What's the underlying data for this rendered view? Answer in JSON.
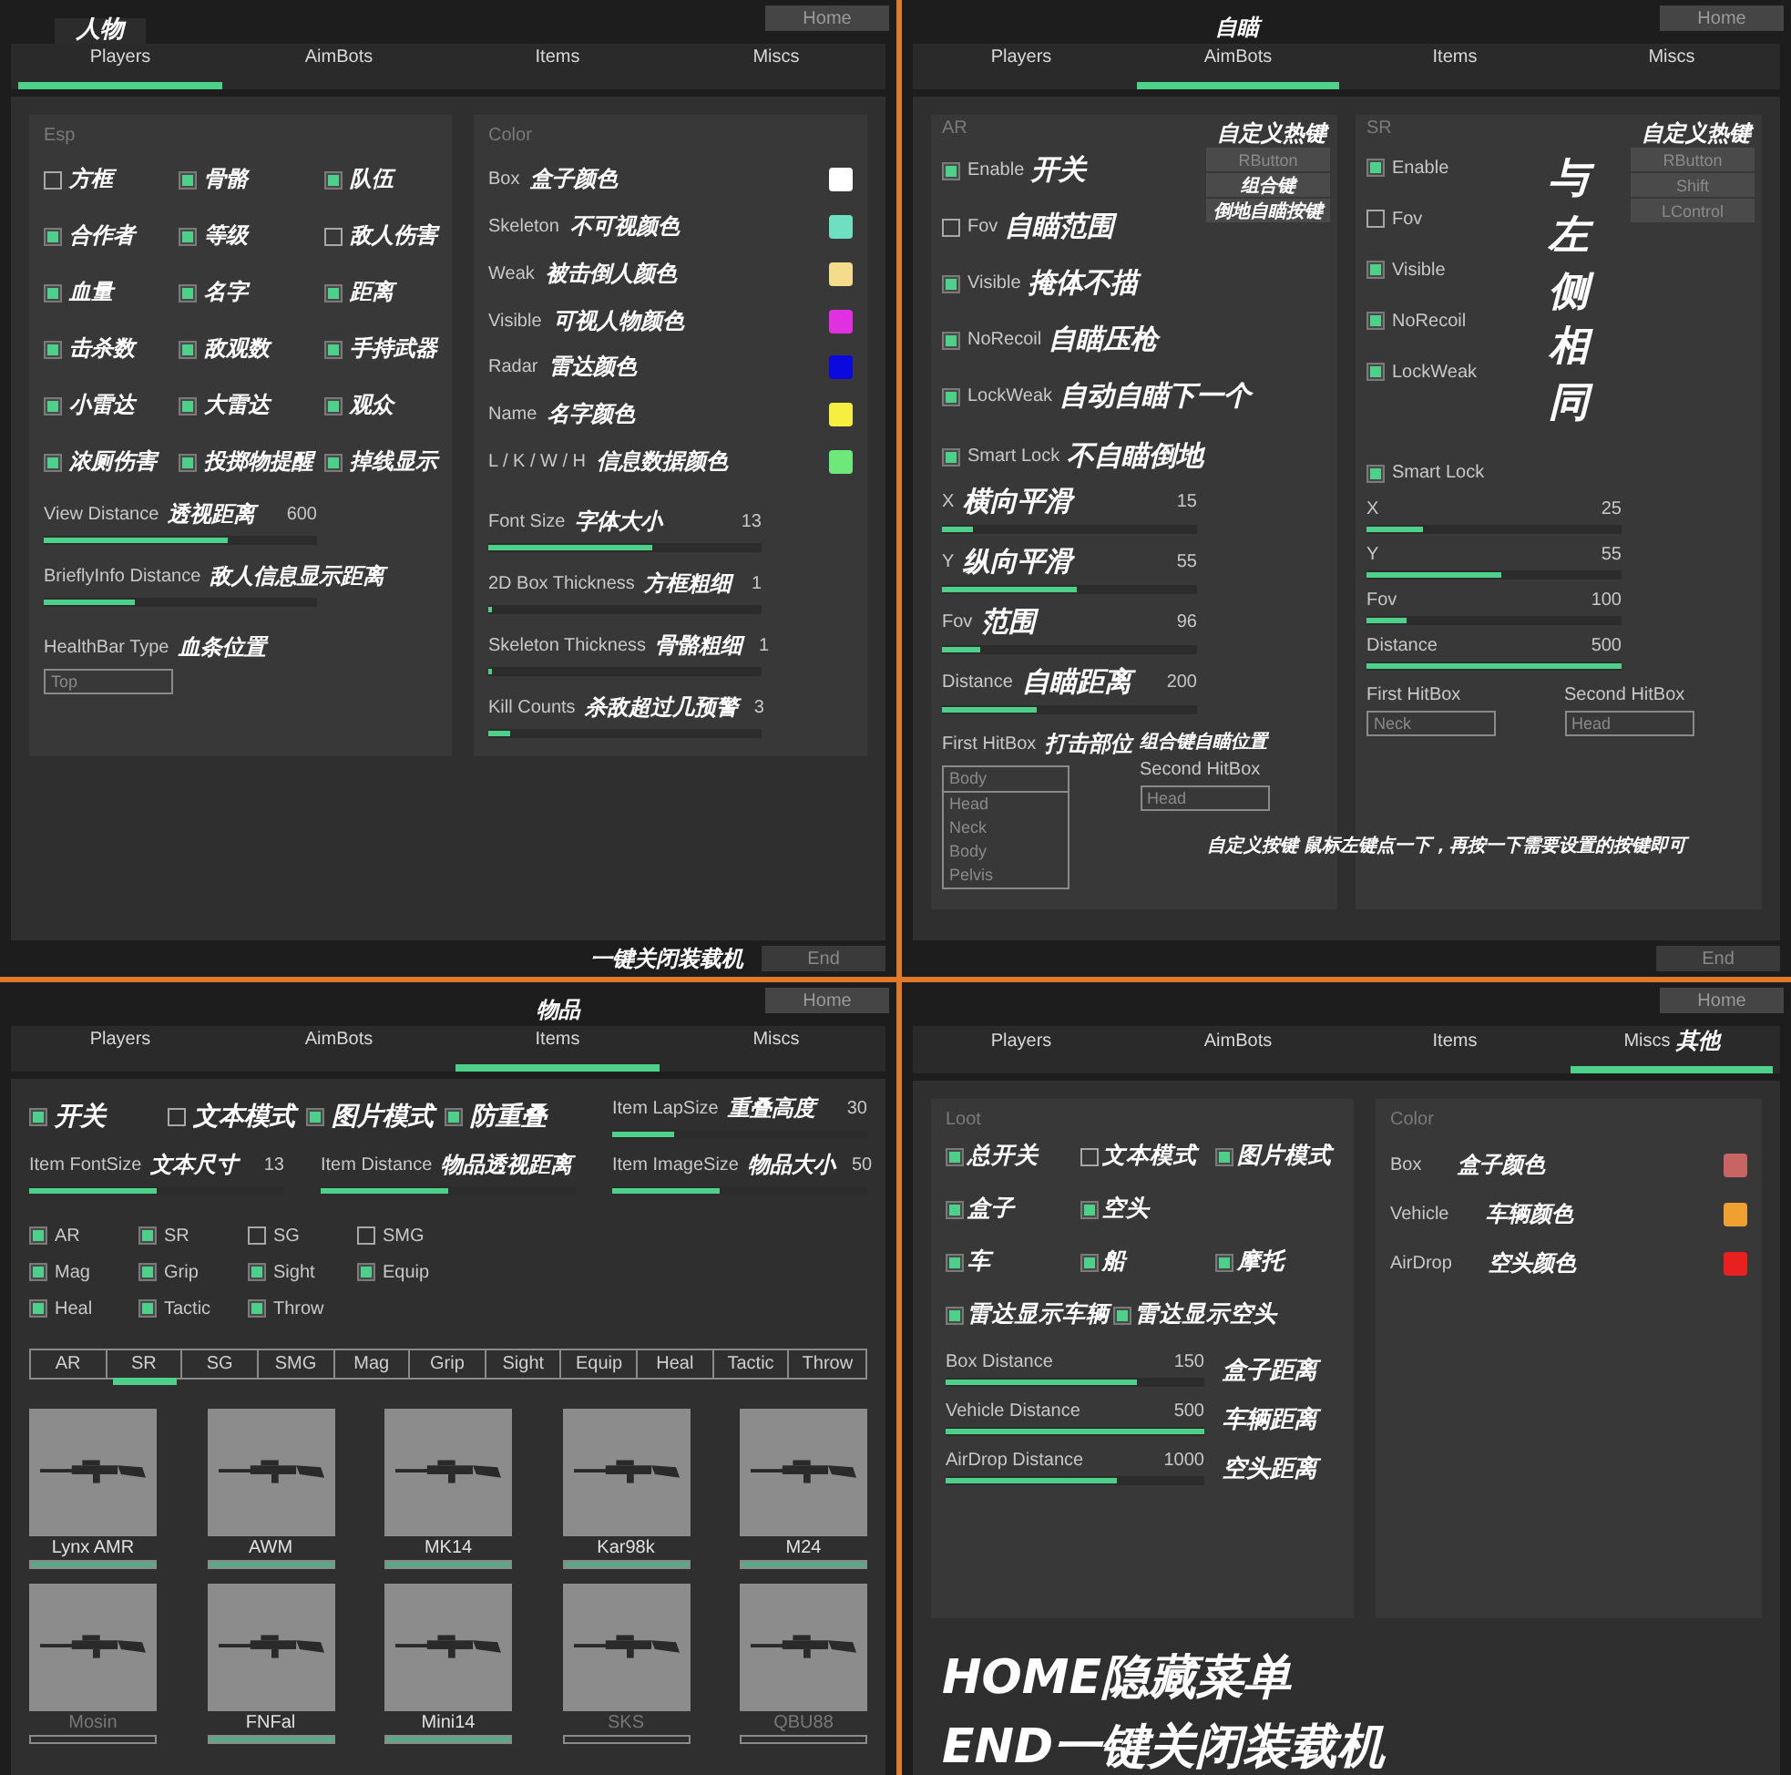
{
  "panels": [
    {
      "kind": "players",
      "title_note": "人物",
      "home": "Home",
      "tabs": [
        {
          "label": "Players",
          "selected": true
        },
        {
          "label": "AimBots",
          "selected": false
        },
        {
          "label": "Items",
          "selected": false
        },
        {
          "label": "Miscs",
          "selected": false
        }
      ],
      "esp": {
        "title": "Esp",
        "checks": [
          {
            "note": "方框",
            "checked": false
          },
          {
            "note": "骨骼",
            "checked": true
          },
          {
            "note": "队伍",
            "checked": true
          },
          {
            "note": "合作者",
            "checked": true
          },
          {
            "note": "等级",
            "checked": true
          },
          {
            "note": "敌人伤害",
            "checked": false
          },
          {
            "note": "血量",
            "checked": true
          },
          {
            "note": "名字",
            "checked": true
          },
          {
            "note": "距离",
            "checked": true
          },
          {
            "note": "击杀数",
            "checked": true
          },
          {
            "note": "敌观数",
            "checked": true
          },
          {
            "note": "手持武器",
            "checked": true
          },
          {
            "note": "小雷达",
            "checked": true
          },
          {
            "note": "大雷达",
            "checked": true
          },
          {
            "note": "观众",
            "checked": true
          },
          {
            "note": "浓厕伤害",
            "checked": true
          },
          {
            "note": "投掷物提醒",
            "checked": true
          },
          {
            "note": "掉线显示",
            "checked": true
          }
        ],
        "sliders": [
          {
            "label": "View Distance",
            "note": "透视距离",
            "value": "600",
            "level": 0.67
          },
          {
            "label": "BrieflyInfo Distance",
            "note": "敌人信息显示距离",
            "level": 0.33
          }
        ],
        "healthbar": {
          "label": "HealthBar Type",
          "note": "血条位置",
          "value": "Top"
        }
      },
      "color": {
        "title": "Color",
        "rows": [
          {
            "label": "Box",
            "note": "盒子颜色",
            "color": "#ffffff"
          },
          {
            "label": "Skeleton",
            "note": "不可视颜色",
            "color": "#6ee0c0"
          },
          {
            "label": "Weak",
            "note": "被击倒人颜色",
            "color": "#f5dc8c"
          },
          {
            "label": "Visible",
            "note": "可视人物颜色",
            "color": "#e030e0"
          },
          {
            "label": "Radar",
            "note": "雷达颜色",
            "color": "#0a0ae0"
          },
          {
            "label": "Name",
            "note": "名字颜色",
            "color": "#f5f040"
          },
          {
            "label": "L / K / W / H",
            "note": "信息数据颜色",
            "color": "#6ee878"
          }
        ],
        "sliders": [
          {
            "label": "Font Size",
            "note": "字体大小",
            "value": "13",
            "level": 0.6
          },
          {
            "label": "2D Box Thickness",
            "note": "方框粗细",
            "value": "1",
            "level": 0.01
          },
          {
            "label": "Skeleton Thickness",
            "note": "骨骼粗细",
            "value": "1",
            "level": 0.01
          },
          {
            "label": "Kill Counts",
            "note": "杀敌超过几预警",
            "value": "3",
            "level": 0.08
          }
        ]
      },
      "footer_note": "一键关闭装载机",
      "end": "End"
    },
    {
      "kind": "aimbots",
      "title_note": "自瞄",
      "home": "Home",
      "tabs": [
        {
          "label": "Players",
          "selected": false
        },
        {
          "label": "AimBots",
          "selected": true
        },
        {
          "label": "Items",
          "selected": false
        },
        {
          "label": "Miscs",
          "selected": false
        }
      ],
      "groups": [
        {
          "title": "AR",
          "hotkey_note": "自定义热键",
          "keys": [
            {
              "kind": "key",
              "text": "RButton"
            },
            {
              "kind": "note",
              "text": "组合键"
            },
            {
              "kind": "note",
              "text": "倒地自瞄按键"
            }
          ],
          "checks": [
            {
              "label": "Enable",
              "note": "开关",
              "checked": true
            },
            {
              "label": "Fov",
              "note": "自瞄范围",
              "checked": false
            },
            {
              "label": "Visible",
              "note": "掩体不描",
              "checked": true
            },
            {
              "label": "NoRecoil",
              "note": "自瞄压枪",
              "checked": true
            },
            {
              "label": "LockWeak",
              "note": "自动自瞄下一个",
              "checked": true
            }
          ],
          "smart_lock": {
            "label": "Smart Lock",
            "note": "不自瞄倒地",
            "checked": true
          },
          "sliders": [
            {
              "label": "X",
              "note": "横向平滑",
              "value": "15",
              "level": 0.12
            },
            {
              "label": "Y",
              "note": "纵向平滑",
              "value": "55",
              "level": 0.53
            },
            {
              "label": "Fov",
              "note": "范围",
              "value": "96",
              "level": 0.15
            },
            {
              "label": "Distance",
              "note": "自瞄距离",
              "value": "200",
              "level": 0.37
            }
          ],
          "first_hitbox": {
            "kind": "list",
            "label": "First HitBox",
            "note": "打击部位",
            "options": [
              {
                "text": "Body",
                "selected": true
              },
              {
                "text": "Head",
                "selected": false
              },
              {
                "text": "Neck",
                "selected": false
              },
              {
                "text": "Body",
                "selected": false
              },
              {
                "text": "Pelvis",
                "selected": false
              }
            ]
          },
          "second_hitbox": {
            "label": "Second HitBox",
            "note": "组合键自瞄位置",
            "value": "Head"
          }
        },
        {
          "title": "SR",
          "hotkey_note": "自定义热键",
          "side_note": "与左侧相同",
          "keys": [
            {
              "kind": "key",
              "text": "RButton"
            },
            {
              "kind": "key",
              "text": "Shift"
            },
            {
              "kind": "key",
              "text": "LControl"
            }
          ],
          "checks": [
            {
              "label": "Enable",
              "checked": true
            },
            {
              "label": "Fov",
              "checked": false
            },
            {
              "label": "Visible",
              "checked": true
            },
            {
              "label": "NoRecoil",
              "checked": true
            },
            {
              "label": "LockWeak",
              "checked": true
            }
          ],
          "smart_lock": {
            "label": "Smart Lock",
            "checked": true
          },
          "sliders": [
            {
              "label": "X",
              "value": "25",
              "level": 0.22
            },
            {
              "label": "Y",
              "value": "55",
              "level": 0.53
            },
            {
              "label": "Fov",
              "value": "100",
              "level": 0.16
            },
            {
              "label": "Distance",
              "value": "500",
              "level": 1.0
            }
          ],
          "first_hitbox": {
            "kind": "field",
            "label": "First HitBox",
            "value": "Neck"
          },
          "second_hitbox": {
            "label": "Second HitBox",
            "value": "Head"
          }
        }
      ],
      "hint_note": "自定义按键 鼠标左键点一下，再按一下需要设置的按键即可",
      "end": "End"
    },
    {
      "kind": "items",
      "title_note": "物品",
      "home": "Home",
      "tabs": [
        {
          "label": "Players",
          "selected": false
        },
        {
          "label": "AimBots",
          "selected": false
        },
        {
          "label": "Items",
          "selected": true
        },
        {
          "label": "Miscs",
          "selected": false
        }
      ],
      "checks": [
        {
          "note": "开关",
          "checked": true
        },
        {
          "note": "文本模式",
          "checked": false
        },
        {
          "note": "图片模式",
          "checked": true
        },
        {
          "note": "防重叠",
          "checked": true
        }
      ],
      "lap": {
        "label": "Item LapSize",
        "note": "重叠高度",
        "value": "30",
        "level": 0.24
      },
      "sliders": [
        {
          "label": "Item FontSize",
          "note": "文本尺寸",
          "value": "13",
          "level": 0.5
        },
        {
          "label": "Item Distance",
          "note": "物品透视距离",
          "level": 0.5
        },
        {
          "label": "Item ImageSize",
          "note": "物品大小",
          "value": "50",
          "level": 0.42
        }
      ],
      "categories": [
        {
          "label": "AR",
          "checked": true
        },
        {
          "label": "SR",
          "checked": true
        },
        {
          "label": "SG",
          "checked": false
        },
        {
          "label": "SMG",
          "checked": false
        },
        {
          "label": "Mag",
          "checked": true
        },
        {
          "label": "Grip",
          "checked": true
        },
        {
          "label": "Sight",
          "checked": true
        },
        {
          "label": "Equip",
          "checked": true
        },
        {
          "label": "Heal",
          "checked": true
        },
        {
          "label": "Tactic",
          "checked": true
        },
        {
          "label": "Throw",
          "checked": true
        }
      ],
      "category_tabs": [
        {
          "label": "AR",
          "selected": false
        },
        {
          "label": "SR",
          "selected": true
        },
        {
          "label": "SG",
          "selected": false
        },
        {
          "label": "SMG",
          "selected": false
        },
        {
          "label": "Mag",
          "selected": false
        },
        {
          "label": "Grip",
          "selected": false
        },
        {
          "label": "Sight",
          "selected": false
        },
        {
          "label": "Equip",
          "selected": false
        },
        {
          "label": "Heal",
          "selected": false
        },
        {
          "label": "Tactic",
          "selected": false
        },
        {
          "label": "Throw",
          "selected": false
        }
      ],
      "items": [
        {
          "name": "Lynx AMR",
          "on": true
        },
        {
          "name": "AWM",
          "on": true
        },
        {
          "name": "MK14",
          "on": true
        },
        {
          "name": "Kar98k",
          "on": true
        },
        {
          "name": "M24",
          "on": true
        },
        {
          "name": "Mosin",
          "on": false
        },
        {
          "name": "FNFal",
          "on": true
        },
        {
          "name": "Mini14",
          "on": true
        },
        {
          "name": "SKS",
          "on": false
        },
        {
          "name": "QBU88",
          "on": false
        }
      ]
    },
    {
      "kind": "miscs",
      "home": "Home",
      "tabs": [
        {
          "label": "Players",
          "selected": false
        },
        {
          "label": "AimBots",
          "selected": false
        },
        {
          "label": "Items",
          "selected": false
        },
        {
          "label": "Miscs",
          "selected": true,
          "note": "其他"
        }
      ],
      "loot": {
        "title": "Loot",
        "check_rows": [
          [
            {
              "note": "总开关",
              "checked": true
            },
            {
              "note": "文本模式",
              "checked": false
            },
            {
              "note": "图片模式",
              "checked": true
            }
          ],
          [
            {
              "note": "盒子",
              "checked": true
            },
            {
              "note": "空头",
              "checked": true
            }
          ],
          [
            {
              "note": "车",
              "checked": true
            },
            {
              "note": "船",
              "checked": true
            },
            {
              "note": "摩托",
              "checked": true
            }
          ],
          [
            {
              "note": "雷达显示车辆",
              "checked": true
            },
            {
              "note": "雷达显示空头",
              "checked": true
            }
          ]
        ],
        "sliders": [
          {
            "label": "Box Distance",
            "note": "盒子距离",
            "value": "150",
            "level": 0.74
          },
          {
            "label": "Vehicle Distance",
            "note": "车辆距离",
            "value": "500",
            "level": 1.0
          },
          {
            "label": "AirDrop Distance",
            "note": "空头距离",
            "value": "1000",
            "level": 0.66
          }
        ]
      },
      "color": {
        "title": "Color",
        "rows": [
          {
            "label": "Box",
            "note": "盒子颜色",
            "color": "#c86464"
          },
          {
            "label": "Vehicle",
            "note": "车辆颜色",
            "color": "#f0a030"
          },
          {
            "label": "AirDrop",
            "note": "空头颜色",
            "color": "#e82020"
          }
        ]
      },
      "big_notes": [
        "HOME隐藏菜单",
        "END一键关闭装载机"
      ]
    }
  ]
}
